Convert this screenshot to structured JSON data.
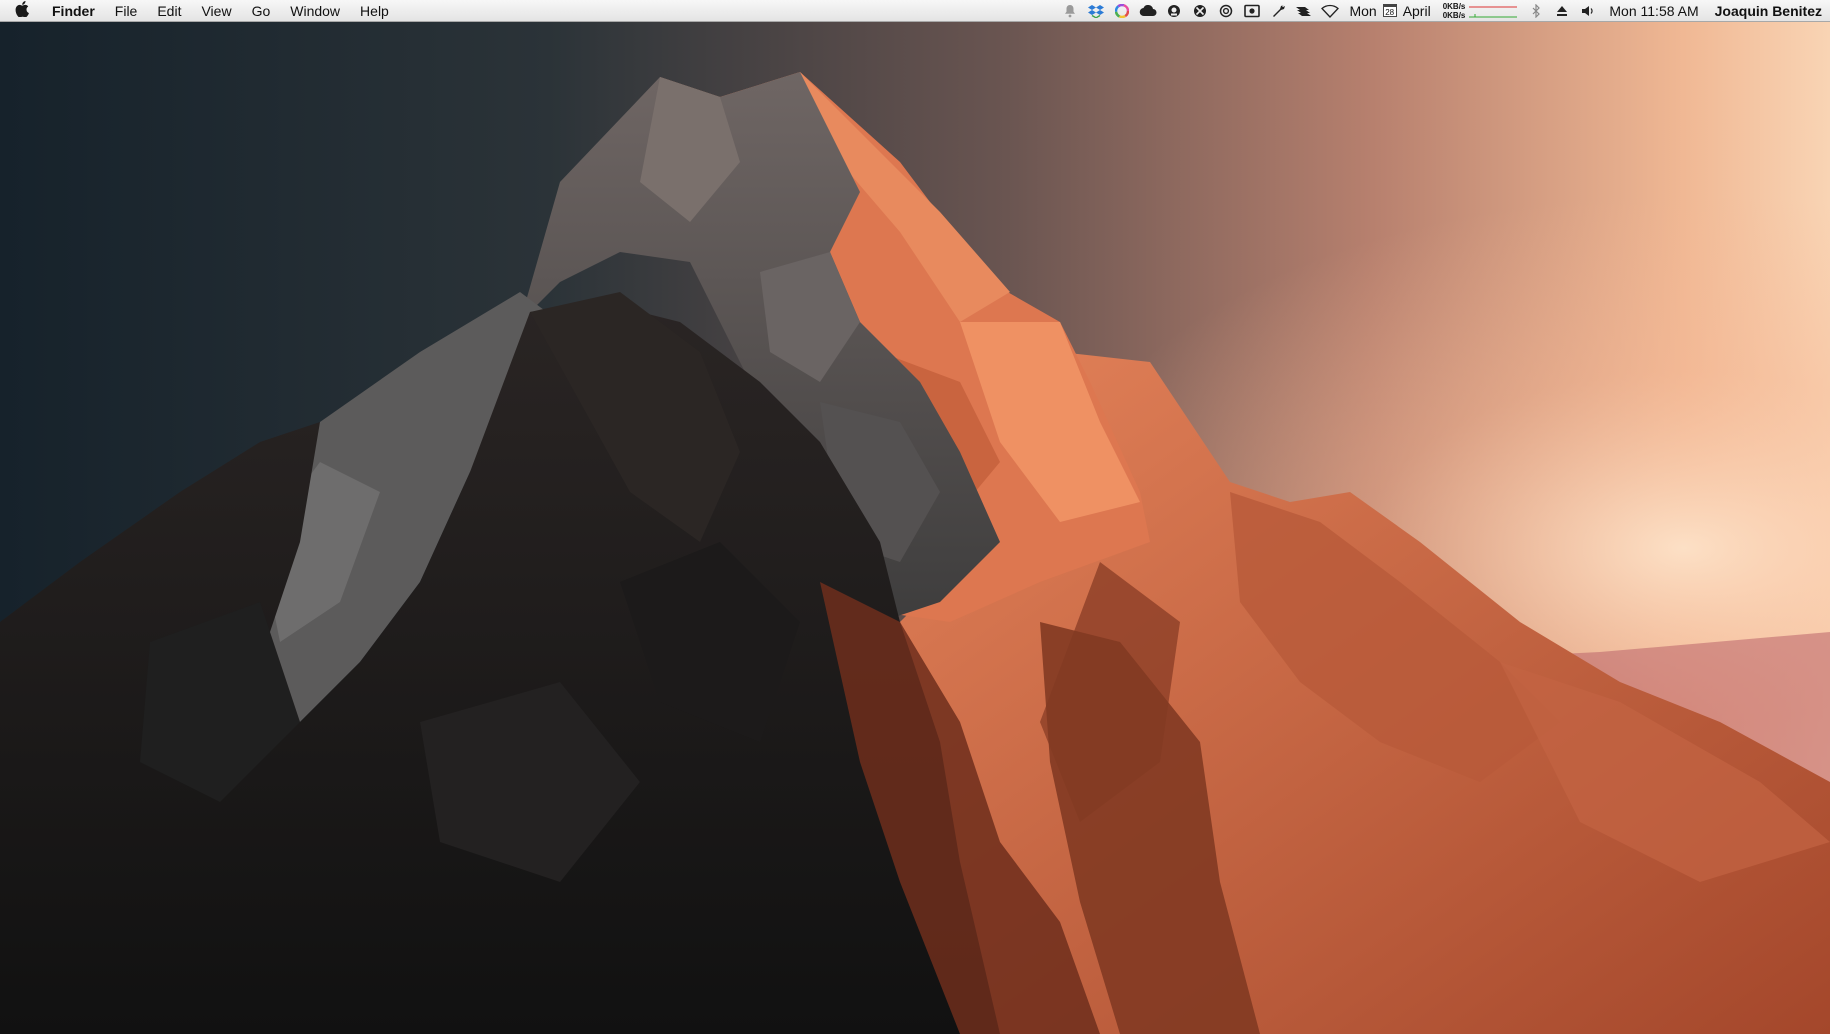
{
  "menubar": {
    "app_name": "Finder",
    "menus": [
      "File",
      "Edit",
      "View",
      "Go",
      "Window",
      "Help"
    ],
    "status": {
      "network_up": "0KB/s",
      "network_down": "0KB/s",
      "calendar_day_name": "Mon",
      "calendar_date": "28",
      "calendar_month": "April",
      "clock": "Mon 11:58 AM",
      "user_name": "Joaquin Benitez"
    },
    "icons": [
      "notification-bell-icon",
      "dropbox-icon",
      "color-wheel-icon",
      "cloud-icon",
      "monitor-icon",
      "compass-icon",
      "clock-icon",
      "screenshot-icon",
      "wrench-icon",
      "stack-icon",
      "wifi-icon",
      "bluetooth-icon",
      "eject-icon",
      "volume-icon"
    ]
  },
  "desktop": {
    "wallpaper": "low-poly mountain at sunset",
    "colors": {
      "sky_left": "#16222b",
      "sky_right": "#f6c8a0",
      "mountain_lit": "#d9714a",
      "mountain_shadow": "#1b1a1a",
      "mountain_grey": "#5b5a5a"
    }
  }
}
